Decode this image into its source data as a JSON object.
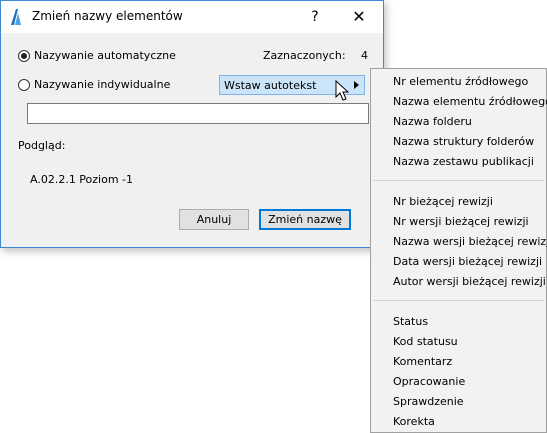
{
  "dialog": {
    "title": "Zmień nazwy elementów",
    "help": "?",
    "close": "✕",
    "auto_naming_label": "Nazywanie automatyczne",
    "individual_naming_label": "Nazywanie indywidualne",
    "auto_naming_selected": true,
    "selected_count_label": "Zaznaczonych:",
    "selected_count": "4",
    "insert_autotext_label": "Wstaw autotekst",
    "text_value": "",
    "preview_label": "Podgląd:",
    "preview_value": "A.02.2.1 Poziom -1",
    "cancel_label": "Anuluj",
    "rename_label": "Zmień nazwę"
  },
  "menu": {
    "group1": [
      "Nr elementu źródłowego",
      "Nazwa elementu źródłowego",
      "Nazwa folderu",
      "Nazwa struktury folderów",
      "Nazwa zestawu publikacji"
    ],
    "group2": [
      "Nr bieżącej rewizji",
      "Nr wersji bieżącej rewizji",
      "Nazwa wersji bieżącej rewizji",
      "Data wersji bieżącej rewizji",
      "Autor wersji bieżącej rewizji"
    ],
    "group3": [
      "Status",
      "Kod statusu",
      "Komentarz",
      "Opracowanie",
      "Sprawdzenie",
      "Korekta"
    ]
  }
}
